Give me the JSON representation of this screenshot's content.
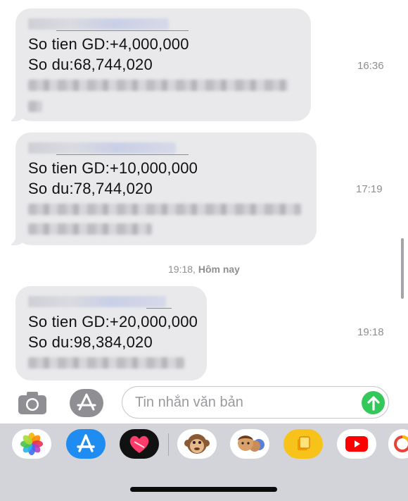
{
  "messages": [
    {
      "amount": "So tien GD:+4,000,000",
      "balance": "So du:68,744,020",
      "time": "16:36"
    },
    {
      "amount": "So tien GD:+10,000,000",
      "balance": "So du:78,744,020",
      "time": "17:19"
    },
    {
      "amount": "So tien GD:+20,000,000",
      "balance": "So du:98,384,020",
      "time": "19:18"
    }
  ],
  "date_separator": {
    "time": "19:18,",
    "day": "Hôm nay"
  },
  "input": {
    "placeholder": "Tin nhắn văn bản"
  },
  "icons": {
    "camera": "camera-icon",
    "appstore": "app-store-icon",
    "send": "send-arrow-icon"
  },
  "app_drawer": [
    "photos",
    "app-store",
    "digital-touch",
    "monkey-memoji",
    "memoji-stickers",
    "stickers-app",
    "youtube",
    "more-app"
  ],
  "colors": {
    "bubble": "#e9e9eb",
    "send": "#34c759",
    "drawer": "#d2d4d9",
    "appstore": "#1e8cf0",
    "youtube": "#ff0000"
  }
}
